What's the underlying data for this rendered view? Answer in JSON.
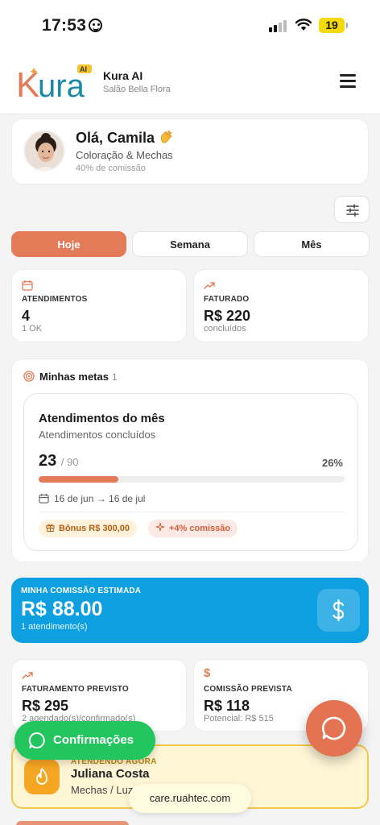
{
  "status_bar": {
    "time": "17:53",
    "battery": "19"
  },
  "header": {
    "logo_text": "Kura",
    "logo_badge": "AI",
    "brand_title": "Kura AI",
    "brand_subtitle": "Salão Bella Flora",
    "menu_icon": "hamburger-menu-icon"
  },
  "profile": {
    "greeting": "Olá, Camila",
    "role": "Coloração & Mechas",
    "commission_rate": "40% de comissão"
  },
  "tabs": [
    {
      "label": "Hoje",
      "active": true
    },
    {
      "label": "Semana",
      "active": false
    },
    {
      "label": "Mês",
      "active": false
    }
  ],
  "stats": {
    "appointments": {
      "label": "ATENDIMENTOS",
      "value": "4",
      "sub": "1 OK"
    },
    "billed": {
      "label": "FATURADO",
      "value": "R$ 220",
      "sub": "concluídos"
    }
  },
  "goals": {
    "title": "Minhas metas",
    "count": "1",
    "goal": {
      "title": "Atendimentos do mês",
      "subtitle": "Atendimentos concluídos",
      "current": "23",
      "target": "/ 90",
      "percent": "26%",
      "progress": 0.26,
      "dates": "16 de jun → 16 de jul",
      "bonus": "Bônus R$ 300,00",
      "extra_commission": "+4% comissão"
    }
  },
  "commission": {
    "label": "MINHA COMISSÃO ESTIMADA",
    "value": "R$ 88.00",
    "sub": "1 atendimento(s)"
  },
  "forecast": {
    "revenue": {
      "label": "FATURAMENTO PREVISTO",
      "value": "R$ 295",
      "sub": "2 agendado(s)/confirmado(s)"
    },
    "commission": {
      "label": "COMISSÃO PREVISTA",
      "value": "R$ 118",
      "sub": "Potencial: R$ 515"
    }
  },
  "now_attending": {
    "label": "ATENDENDO AGORA",
    "name": "Juliana Costa",
    "service": "Mechas / Luzes"
  },
  "floating": {
    "confirm_label": "Confirmações",
    "url": "care.ruahtec.com"
  },
  "colors": {
    "accent": "#e37b59",
    "blue": "#0d9fe0",
    "green": "#22c55e",
    "highlight": "#f2c84b"
  }
}
